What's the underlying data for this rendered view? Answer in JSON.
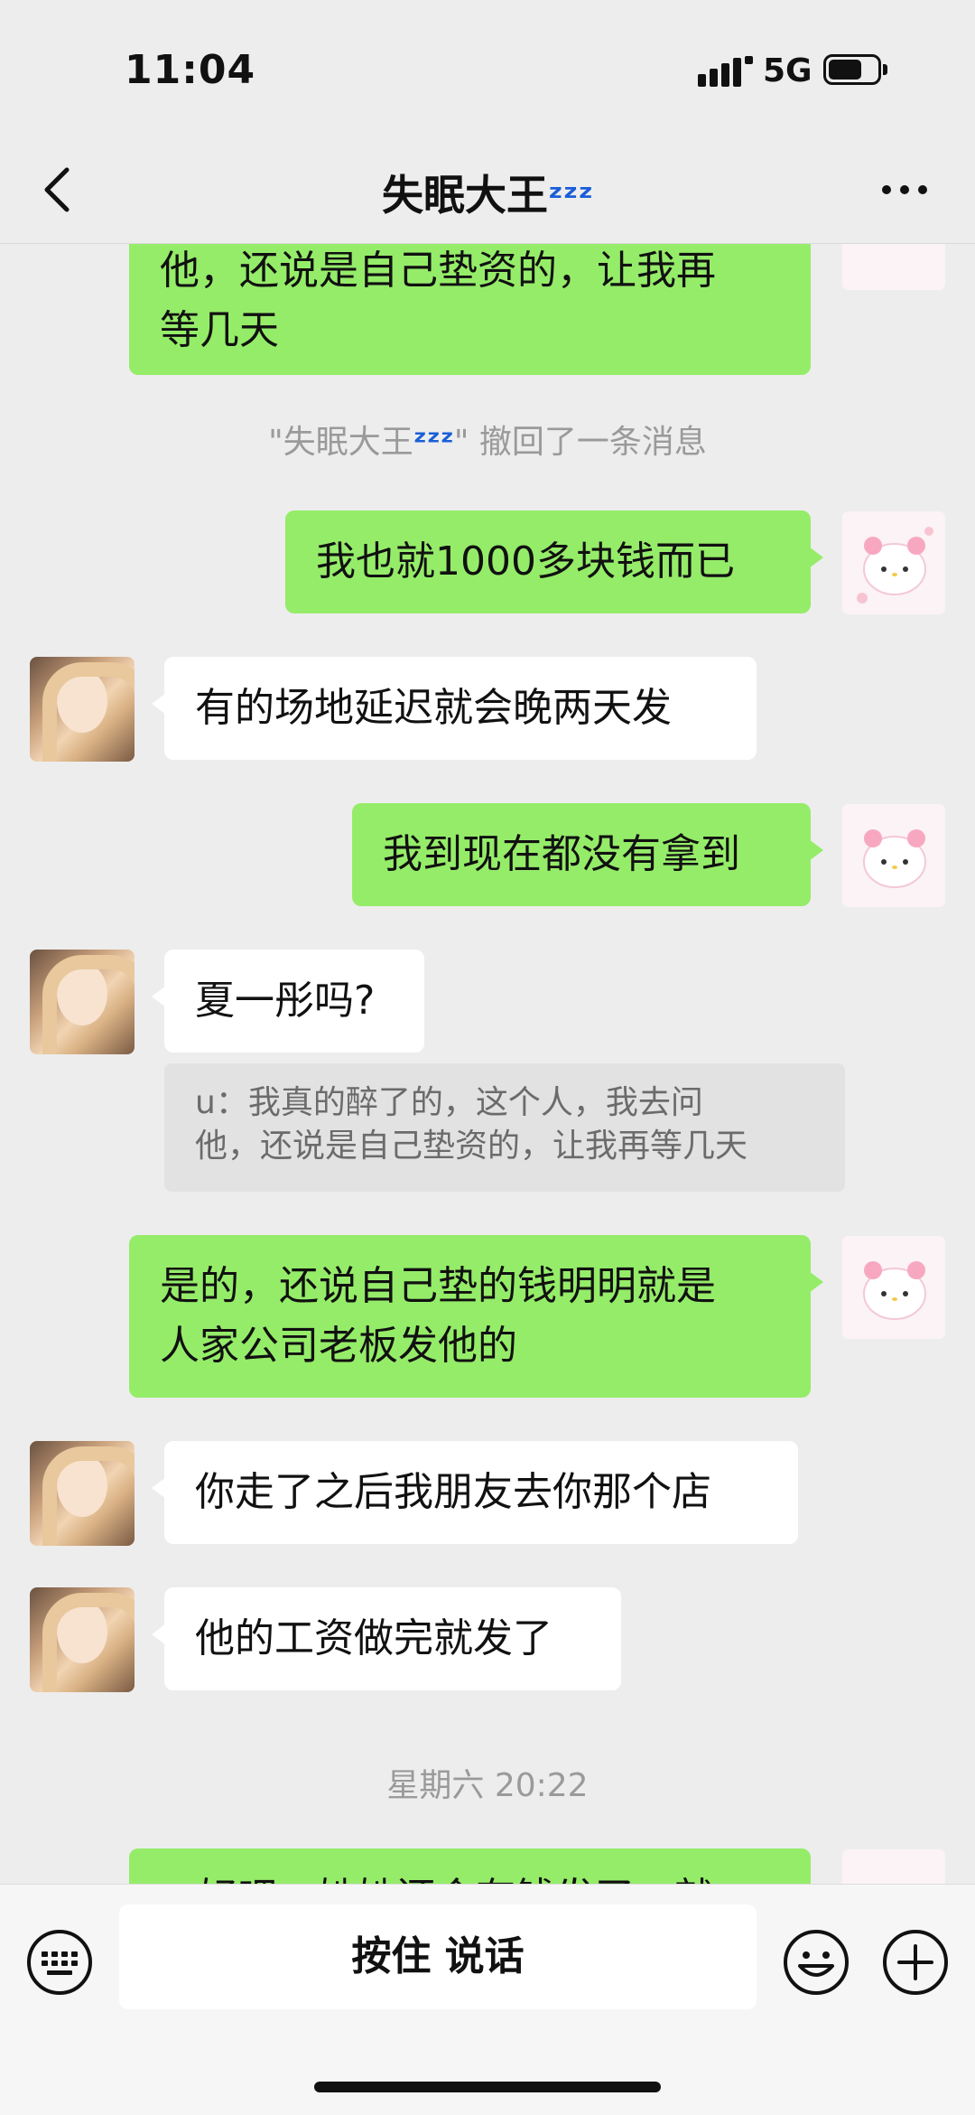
{
  "status": {
    "time": "11:04",
    "network": "5G"
  },
  "nav": {
    "title": "失眠大王",
    "title_emoji": "ᶻᶻᶻ"
  },
  "messages": {
    "m0": {
      "line1": "他，还说是自己垫资的，让我再",
      "line2": "等几天"
    },
    "recall": {
      "name": "\"失眠大王",
      "emoji": "ᶻᶻᶻ",
      "suffix": "\" 撤回了一条消息"
    },
    "m1": "我也就1000多块钱而已",
    "m2": "有的场地延迟就会晚两天发",
    "m3": "我到现在都没有拿到",
    "m4": "夏一彤吗?",
    "quote": {
      "line1": "u：我真的醉了的，这个人，我去问",
      "line2": "他，还说是自己垫资的，让我再等几天"
    },
    "m5": {
      "line1": "是的，还说自己垫的钱明明就是",
      "line2": "人家公司老板发他的"
    },
    "m6": "你走了之后我朋友去你那个店",
    "m7": "他的工资做完就发了",
    "timestamp": "星期六 20:22",
    "m8_partial": "...好吧，她她还会有钱发了，就"
  },
  "input": {
    "talk_label": "按住 说话"
  },
  "icons": {
    "back": "chevron-left-icon",
    "more": "more-dots-icon",
    "keyboard": "keyboard-icon",
    "emoji": "emoji-icon",
    "plus": "plus-icon"
  },
  "colors": {
    "outgoing_bubble": "#95ec69",
    "incoming_bubble": "#ffffff",
    "background": "#ededed",
    "zzz": "#1a5fd8"
  }
}
